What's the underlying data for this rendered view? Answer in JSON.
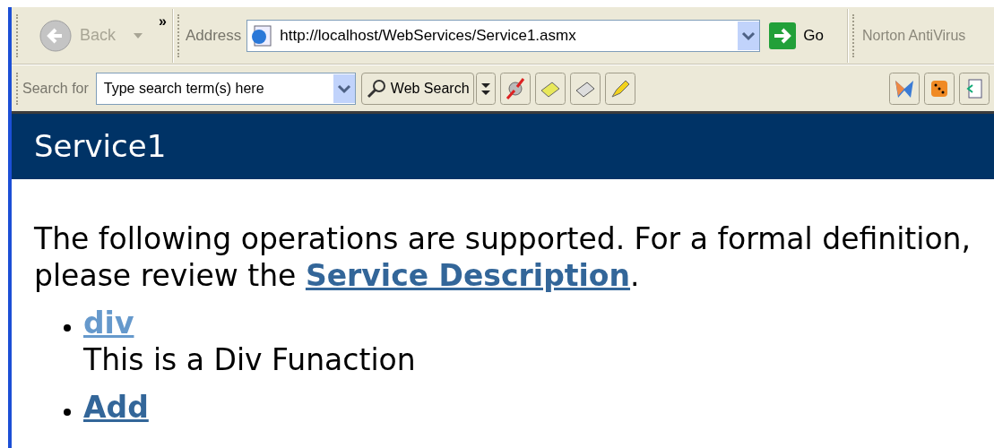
{
  "toolbar": {
    "back": {
      "label": "Back",
      "disabled": true
    },
    "chevron": "»",
    "address_label": "Address",
    "address": "http://localhost/WebServices/Service1.asmx",
    "go": "Go",
    "norton": "Norton AntiVirus"
  },
  "search_bar": {
    "label": "Search for",
    "value": "Type search term(s) here",
    "button": "Web Search"
  },
  "page": {
    "title": "Service1",
    "intro_before": "The following operations are supported. For a formal definition, please review the ",
    "intro_link": "Service Description",
    "intro_after": ".",
    "operations": [
      {
        "name": "div",
        "visited": true,
        "description": "This is a Div Funaction"
      },
      {
        "name": "Add",
        "visited": false
      }
    ]
  }
}
